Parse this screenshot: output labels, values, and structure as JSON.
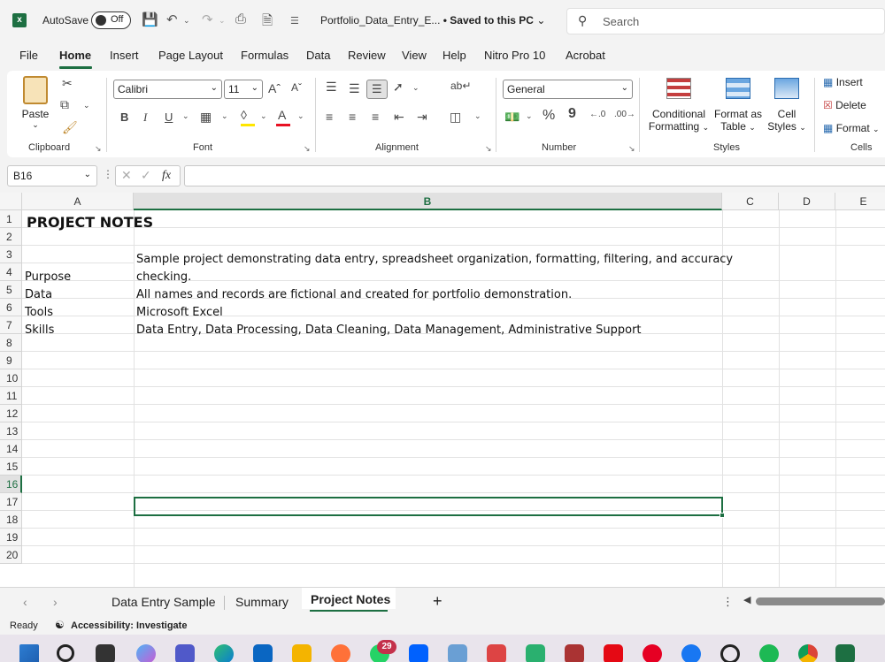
{
  "titlebar": {
    "app_icon": "excel-logo-icon",
    "autosave_label": "AutoSave",
    "autosave_state": "Off",
    "doc_title": "Portfolio_Data_Entry_E...",
    "save_status": "• Saved to this PC",
    "search_placeholder": "Search"
  },
  "menu": {
    "tabs": [
      "File",
      "Home",
      "Insert",
      "Page Layout",
      "Formulas",
      "Data",
      "Review",
      "View",
      "Help",
      "Nitro Pro 10",
      "Acrobat"
    ],
    "active": "Home"
  },
  "ribbon": {
    "groups": [
      "Clipboard",
      "Font",
      "Alignment",
      "Number",
      "Styles",
      "Cells"
    ],
    "paste_label": "Paste",
    "font_name": "Calibri",
    "font_size": "11",
    "number_format": "General",
    "conditional_formatting": "Conditional",
    "conditional_formatting_2": "Formatting",
    "format_as_table": "Format as",
    "format_as_table_2": "Table",
    "cell_styles": "Cell",
    "cell_styles_2": "Styles",
    "insert_label": "Insert",
    "delete_label": "Delete",
    "format_label": "Format",
    "bold": "B",
    "italic": "I",
    "underline": "U",
    "percent": "%",
    "comma": "9",
    "fx": "fx"
  },
  "formula_bar": {
    "name_box": "B16",
    "formula": ""
  },
  "sheet": {
    "columns": [
      "A",
      "B",
      "C",
      "D",
      "E"
    ],
    "selected_column": "B",
    "rows": [
      "1",
      "2",
      "3",
      "4",
      "5",
      "6",
      "7",
      "8",
      "9",
      "10",
      "11",
      "12",
      "13",
      "14",
      "15",
      "16",
      "17",
      "18",
      "19",
      "20"
    ],
    "selected_row": "16",
    "cells": {
      "A1": "PROJECT NOTES",
      "A3": "Purpose",
      "B3_line1": "Sample project demonstrating data entry, spreadsheet organization, formatting, filtering, and accuracy",
      "B3_line2": "checking.",
      "A4": "Data",
      "B4": "All names and records are fictional and created for portfolio demonstration.",
      "A5": "Tools",
      "B5": "Microsoft Excel",
      "A6": "Skills",
      "B6": "Data Entry, Data Processing, Data Cleaning, Data Management, Administrative Support"
    }
  },
  "sheet_tabs": {
    "tabs": [
      "Data Entry Sample",
      "Summary",
      "Project Notes"
    ],
    "active": "Project Notes",
    "add": "+"
  },
  "status": {
    "ready": "Ready",
    "accessibility": "Accessibility: Investigate"
  },
  "taskbar": {
    "notification_count": "29"
  },
  "colors": {
    "excel_green": "#1d6f42",
    "font_red": "#e81123",
    "highlight_yellow": "#ffe600"
  }
}
